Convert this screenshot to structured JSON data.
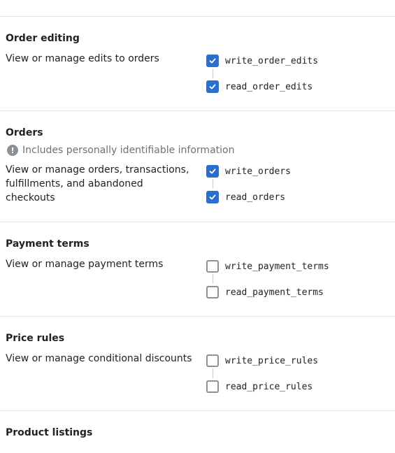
{
  "sections": [
    {
      "title": "Order editing",
      "pii": null,
      "description": "View or manage edits to orders",
      "scopes": [
        {
          "label": "write_order_edits",
          "checked": true
        },
        {
          "label": "read_order_edits",
          "checked": true
        }
      ]
    },
    {
      "title": "Orders",
      "pii": "Includes personally identifiable information",
      "description": "View or manage orders, transactions, fulfillments, and abandoned checkouts",
      "scopes": [
        {
          "label": "write_orders",
          "checked": true
        },
        {
          "label": "read_orders",
          "checked": true
        }
      ]
    },
    {
      "title": "Payment terms",
      "pii": null,
      "description": "View or manage payment terms",
      "scopes": [
        {
          "label": "write_payment_terms",
          "checked": false
        },
        {
          "label": "read_payment_terms",
          "checked": false
        }
      ]
    },
    {
      "title": "Price rules",
      "pii": null,
      "description": "View or manage conditional discounts",
      "scopes": [
        {
          "label": "write_price_rules",
          "checked": false
        },
        {
          "label": "read_price_rules",
          "checked": false
        }
      ]
    },
    {
      "title": "Product listings",
      "pii": null,
      "description": "",
      "scopes": []
    }
  ],
  "icons": {
    "pii": "exclamation-circle-icon",
    "check": "checkmark-icon"
  },
  "colors": {
    "accent": "#2c6ecb",
    "divider": "#e1e3e5",
    "muted": "#6d7175"
  }
}
